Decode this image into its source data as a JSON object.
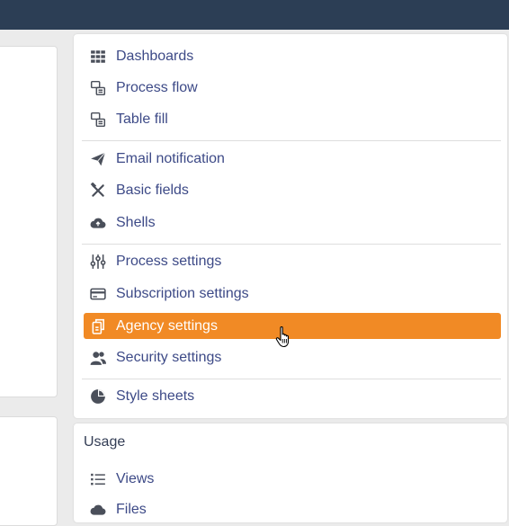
{
  "menu": {
    "items": [
      {
        "label": "Dashboards",
        "icon": "grid-icon"
      },
      {
        "label": "Process flow",
        "icon": "process-flow-icon"
      },
      {
        "label": "Table fill",
        "icon": "table-fill-icon"
      },
      {
        "label": "Email notification",
        "icon": "paper-plane-icon"
      },
      {
        "label": "Basic fields",
        "icon": "tools-icon"
      },
      {
        "label": "Shells",
        "icon": "cloud-upload-icon"
      },
      {
        "label": "Process settings",
        "icon": "sliders-icon"
      },
      {
        "label": "Subscription settings",
        "icon": "credit-card-icon"
      },
      {
        "label": "Agency settings",
        "icon": "agency-icon",
        "active": true
      },
      {
        "label": "Security settings",
        "icon": "users-icon"
      },
      {
        "label": "Style sheets",
        "icon": "pie-chart-icon"
      }
    ]
  },
  "usage": {
    "title": "Usage",
    "items": [
      {
        "label": "Views",
        "icon": "list-icon"
      },
      {
        "label": "Files",
        "icon": "cloud-icon"
      }
    ]
  },
  "colors": {
    "topbar": "#2c3e55",
    "accent": "#f18a25",
    "link": "#3d4a87",
    "icon": "#4a4f5a"
  }
}
